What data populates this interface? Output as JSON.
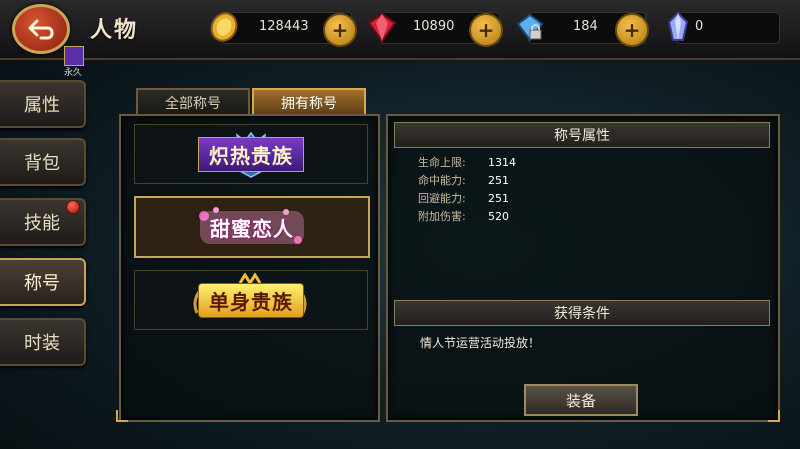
{
  "header": {
    "title": "人物",
    "back_icon": "back-arrow-icon"
  },
  "resources": [
    {
      "name": "gold",
      "icon": "gold-coin-icon",
      "value": "128443",
      "color": "#f0c040"
    },
    {
      "name": "ruby",
      "icon": "red-gem-icon",
      "value": "10890",
      "color": "#e0304a"
    },
    {
      "name": "diamond-bound",
      "icon": "locked-diamond-icon",
      "value": "184",
      "color": "#7ac8ff"
    },
    {
      "name": "crystal",
      "icon": "crystal-icon",
      "value": "0",
      "color": "#a0a8ff"
    }
  ],
  "badge": {
    "label": "永久"
  },
  "nav": {
    "items": [
      {
        "label": "属性"
      },
      {
        "label": "背包"
      },
      {
        "label": "技能"
      },
      {
        "label": "称号"
      },
      {
        "label": "时装"
      }
    ],
    "active": "称号"
  },
  "tabs": [
    {
      "label": "全部称号"
    },
    {
      "label": "拥有称号"
    }
  ],
  "titles": [
    {
      "label": "炽热贵族",
      "color": "#8a4ad8"
    },
    {
      "label": "甜蜜恋人",
      "color": "#e055c8"
    },
    {
      "label": "单身贵族",
      "color": "#f0c030"
    }
  ],
  "detail": {
    "attr_header": "称号属性",
    "stats": [
      {
        "key": "生命上限:",
        "value": "1314"
      },
      {
        "key": "命中能力:",
        "value": "251"
      },
      {
        "key": "回避能力:",
        "value": "251"
      },
      {
        "key": "附加伤害:",
        "value": "520"
      }
    ],
    "cond_header": "获得条件",
    "cond_text": "情人节运营活动投放！",
    "equip_label": "装备"
  }
}
